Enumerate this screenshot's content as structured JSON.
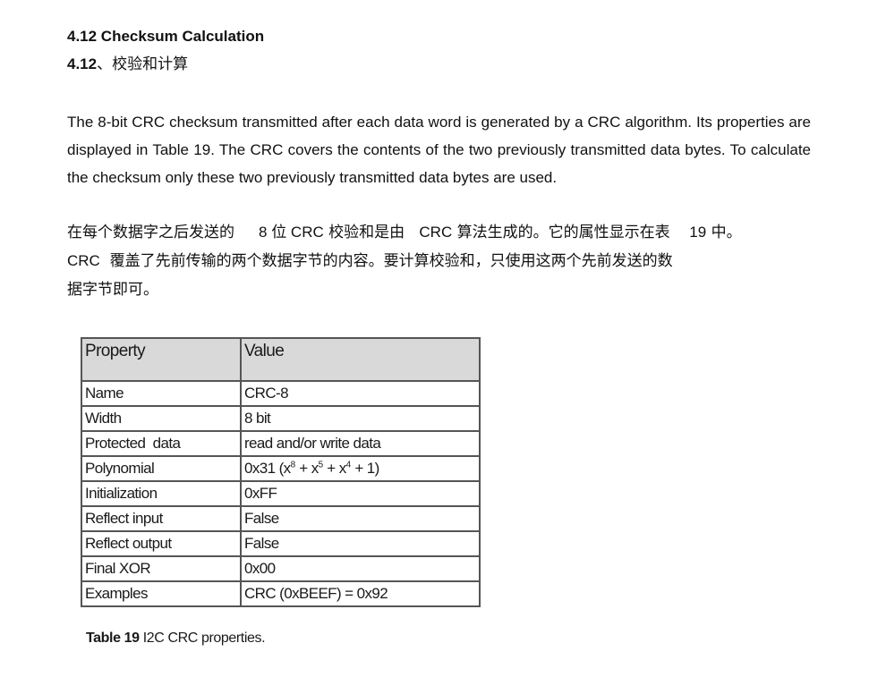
{
  "heading_en": "4.12 Checksum Calculation",
  "heading_cn": {
    "number": "4.12",
    "text": "、校验和计算"
  },
  "paragraph_en": "The 8-bit CRC checksum transmitted after each data word is generated by a CRC algorithm. Its properties are displayed in Table 19. The CRC covers the contents of the two previously transmitted data bytes. To calculate the checksum only these two previously transmitted data bytes are used.",
  "paragraph_cn": {
    "line1": [
      "在每个数据字之后发送的",
      "8 位 CRC",
      "校验和是由",
      "CRC",
      "算法生成的。它的属性显示在表",
      "19",
      "中。"
    ],
    "line2": [
      "CRC",
      "覆盖了先前传输的两个数据字节的内容。要计算校验和，只使用这两个先前发送的数"
    ],
    "line3": "据字节即可。"
  },
  "table": {
    "headers": [
      "Property",
      "Value"
    ],
    "rows": [
      [
        "Name",
        "CRC-8"
      ],
      [
        "Width",
        "8 bit"
      ],
      [
        "Protected  data",
        "read and/or write data"
      ],
      [
        "Polynomial",
        "0x31 (x"
      ],
      [
        "Initialization",
        "0xFF"
      ],
      [
        "Reflect input",
        "False"
      ],
      [
        "Reflect output",
        "False"
      ],
      [
        "Final XOR",
        "0x00"
      ],
      [
        "Examples",
        "CRC (0xBEEF) = 0x92"
      ]
    ],
    "polynomial_parts": [
      "0x31 (x",
      "8",
      " + x",
      "5",
      " + x",
      "4",
      " + 1)"
    ]
  },
  "caption": {
    "label": "Table 19",
    "text": " I2C CRC properties."
  }
}
